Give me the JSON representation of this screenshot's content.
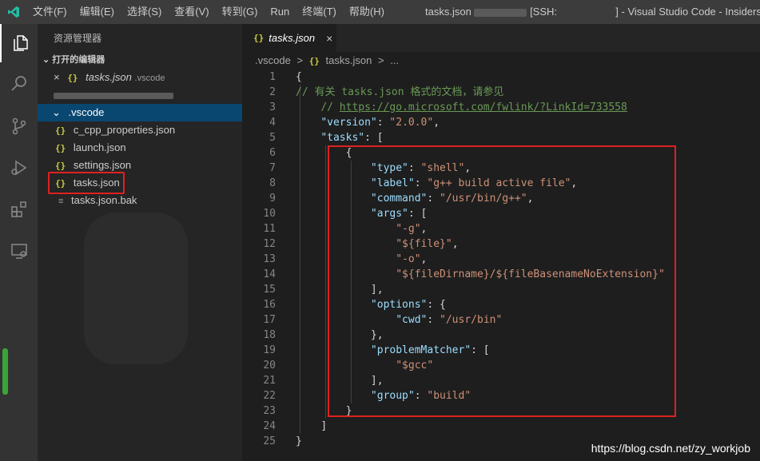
{
  "titlebar": {
    "menu": [
      "文件(F)",
      "编辑(E)",
      "选择(S)",
      "查看(V)",
      "转到(G)",
      "Run",
      "终端(T)",
      "帮助(H)"
    ],
    "title_prefix": "tasks.json",
    "title_ssh": "[SSH:",
    "title_suffix": "] - Visual Studio Code - Insiders"
  },
  "sidebar": {
    "title": "资源管理器",
    "open_editors_header": "打开的编辑器",
    "open_editor": {
      "name": "tasks.json",
      "folder": ".vscode"
    },
    "folder": ".vscode",
    "files": [
      "c_cpp_properties.json",
      "launch.json",
      "settings.json",
      "tasks.json",
      "tasks.json.bak"
    ]
  },
  "tab": {
    "label": "tasks.json",
    "close": "×"
  },
  "breadcrumb": {
    "folder": ".vscode",
    "sep": ">",
    "file": "tasks.json",
    "more": "..."
  },
  "icons": {
    "json": "{}",
    "chevron": "›"
  },
  "code": {
    "line_numbers": [
      "1",
      "2",
      "3",
      "4",
      "5",
      "6",
      "7",
      "8",
      "9",
      "10",
      "11",
      "12",
      "13",
      "14",
      "15",
      "16",
      "17",
      "18",
      "19",
      "20",
      "21",
      "22",
      "23",
      "24",
      "25"
    ],
    "l1": "{",
    "l2": "// 有关 tasks.json 格式的文档，请参见",
    "l3_prefix": "// ",
    "l3_url": "https://go.microsoft.com/fwlink/?LinkId=733558",
    "l4_key": "\"version\"",
    "l4_val": "\"2.0.0\"",
    "l5_key": "\"tasks\"",
    "l5_rest": ": [",
    "l6": "{",
    "l7_key": "\"type\"",
    "l7_val": "\"shell\"",
    "l8_key": "\"label\"",
    "l8_val": "\"g++ build active file\"",
    "l9_key": "\"command\"",
    "l9_val": "\"/usr/bin/g++\"",
    "l10_key": "\"args\"",
    "l10_rest": ": [",
    "l11": "\"-g\"",
    "l12": "\"${file}\"",
    "l13": "\"-o\"",
    "l14": "\"${fileDirname}/${fileBasenameNoExtension}\"",
    "l15": "],",
    "l16_key": "\"options\"",
    "l16_rest": ": {",
    "l17_key": "\"cwd\"",
    "l17_val": "\"/usr/bin\"",
    "l18": "},",
    "l19_key": "\"problemMatcher\"",
    "l19_rest": ": [",
    "l20": "\"$gcc\"",
    "l21": "],",
    "l22_key": "\"group\"",
    "l22_val": "\"build\"",
    "l23": "}",
    "l24": "]",
    "l25": "}"
  },
  "watermark": "https://blog.csdn.net/zy_workjob",
  "colors": {
    "accent": "#e02020",
    "selection": "#094771",
    "json_icon": "#cbcb41"
  }
}
